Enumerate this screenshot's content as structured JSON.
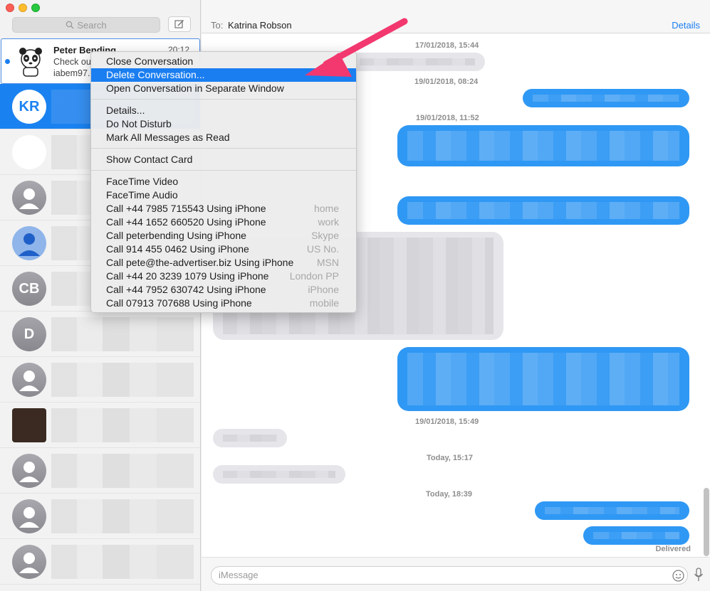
{
  "sidebar": {
    "search_placeholder": "Search",
    "conversations": [
      {
        "name": "Peter Bending",
        "time": "20:12",
        "preview_line1": "Check out",
        "preview_line2": "iabem97.g",
        "unread": true
      },
      {
        "initials": "KR",
        "selected": true
      },
      {
        "initials": ""
      },
      {
        "initials": ""
      },
      {
        "initials": ""
      },
      {
        "initials": "CB"
      },
      {
        "initials": "D"
      },
      {
        "initials": ""
      },
      {
        "initials": ""
      },
      {
        "initials": ""
      },
      {
        "initials": ""
      },
      {
        "initials": ""
      }
    ]
  },
  "header": {
    "to_label": "To:",
    "recipient": "Katrina Robson",
    "details": "Details"
  },
  "messages": {
    "timestamps": [
      "17/01/2018, 15:44",
      "19/01/2018, 08:24",
      "19/01/2018, 11:52",
      "19/01/2018, 15:49",
      "Today, 15:17",
      "Today, 18:39"
    ],
    "status": "Delivered"
  },
  "input": {
    "placeholder": "iMessage"
  },
  "context_menu": {
    "group1": [
      "Close Conversation",
      "Delete Conversation...",
      "Open Conversation in Separate Window"
    ],
    "group2": [
      "Details...",
      "Do Not Disturb",
      "Mark All Messages as Read"
    ],
    "group3": [
      "Show Contact Card"
    ],
    "group4": [
      {
        "label": "FaceTime Video",
        "hint": ""
      },
      {
        "label": "FaceTime Audio",
        "hint": ""
      },
      {
        "label": "Call +44 7985 715543 Using iPhone",
        "hint": "home"
      },
      {
        "label": "Call +44 1652 660520 Using iPhone",
        "hint": "work"
      },
      {
        "label": "Call peterbending Using iPhone",
        "hint": "Skype"
      },
      {
        "label": "Call 914 455 0462 Using iPhone",
        "hint": "US No."
      },
      {
        "label": "Call pete@the-advertiser.biz Using iPhone",
        "hint": "MSN"
      },
      {
        "label": "Call +44 20 3239 1079 Using iPhone",
        "hint": "London PP"
      },
      {
        "label": "Call +44 7952 630742 Using iPhone",
        "hint": "iPhone"
      },
      {
        "label": "Call 07913 707688 Using iPhone",
        "hint": "mobile"
      }
    ],
    "highlighted": "Delete Conversation..."
  },
  "colors": {
    "accent": "#1a7ef0",
    "annotation_arrow": "#f2386f"
  }
}
